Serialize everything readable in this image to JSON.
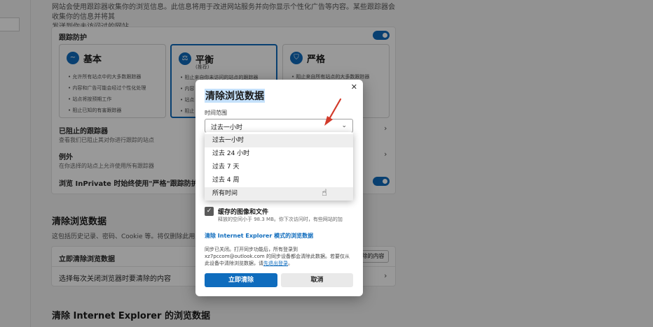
{
  "colors": {
    "accent": "#0f6cbd",
    "annotation": "#d23a2a"
  },
  "background": {
    "intro_line1": "网站会使用跟踪器收集你的浏览信息。此信息将用于改进网站服务并向你显示个性化广告等内容。某些跟踪器会收集你的信息并将其",
    "intro_line2": "发送到你未访问过的网站。",
    "tracking_prevention": {
      "label": "跟踪防护",
      "options": [
        {
          "title": "基本",
          "subtitle": "",
          "icon": "wave-icon",
          "bullets": [
            "允许所有站点中的大多数跟踪器",
            "内容和广告可能会经过个性化处理",
            "站点将按预期工作",
            "阻止已知的有害跟踪器"
          ]
        },
        {
          "title": "平衡",
          "subtitle": "(推荐)",
          "icon": "scale-icon",
          "bullets": [
            "阻止来自你未访问的站点的跟踪器",
            "内容",
            "站点",
            "阻止"
          ]
        },
        {
          "title": "严格",
          "subtitle": "",
          "icon": "shield-icon",
          "bullets": [
            "阻止来自所有站点的大多数跟踪器",
            "",
            "",
            ""
          ]
        }
      ],
      "blocked_title": "已阻止的跟踪器",
      "blocked_desc": "查看我们已阻止其对你进行跟踪的站点",
      "exceptions_title": "例外",
      "exceptions_desc": "在你选择的站点上允许使用所有跟踪器",
      "inprivate_label": "浏览 InPrivate 时始终使用\"严格\"跟踪防护"
    },
    "clear_section": {
      "title": "清除浏览数据",
      "desc": "这包括历史记录、密码、Cookie 等。将仅删除此用户配",
      "row1_title": "立即清除浏览数据",
      "row1_button": "除的内容",
      "row2_title": "选择每次关闭浏览器时要清除的内容"
    },
    "ie_section_title": "清除 Internet Explorer 的浏览数据"
  },
  "dialog": {
    "title": "清除浏览数据",
    "close_label": "✕",
    "time_range_label": "时间范围",
    "selected_value": "过去一小时",
    "options": [
      "过去一小时",
      "过去 24 小时",
      "过去 7 天",
      "过去 4 周",
      "所有时间"
    ],
    "cache_label": "缓存的图像和文件",
    "cache_desc": "释放的空间小于 98.3 MB。你下次访问时，有些网站的加",
    "ie_link": "清除 Internet Explorer 模式的浏览数据",
    "sync_line1": "同步已关闭。打开同步功能后，所有登录到",
    "sync_line2": "xz7pccom@outlook.com 的同步设备都会清除此数据。若要仅从",
    "sync_line3_prefix": "此设备中清除浏览数据，请",
    "sync_link": "先退出登录",
    "sync_line3_suffix": "。",
    "clear_button": "立即清除",
    "cancel_button": "取消"
  }
}
